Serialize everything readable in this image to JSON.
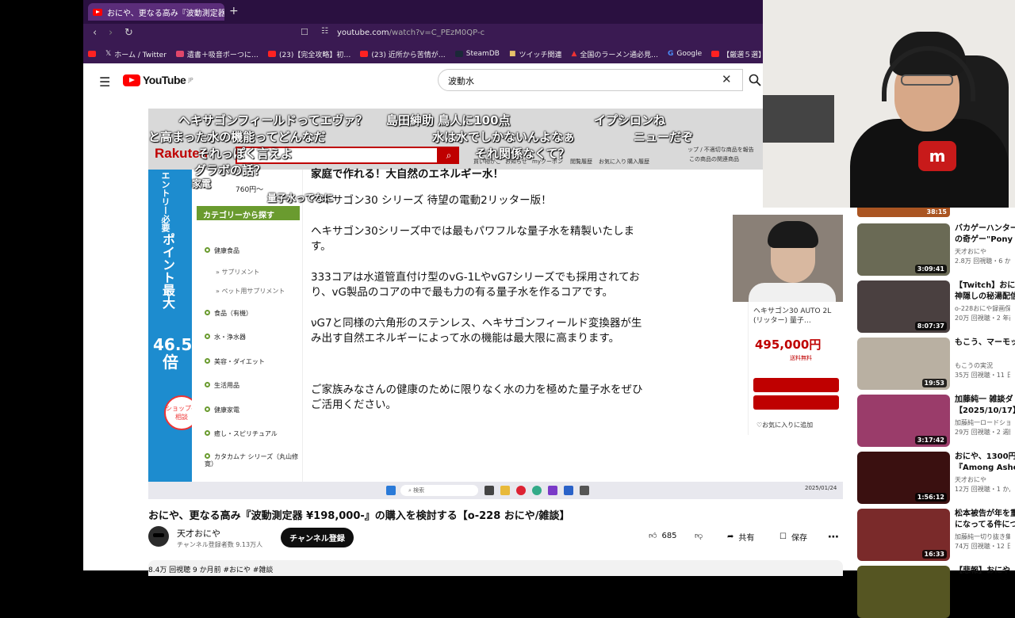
{
  "browser": {
    "tab_title": "おにや、更なる高み『波動測定器",
    "tab_close": "✕",
    "new_tab": "+",
    "url_host": "youtube.com",
    "url_path": "/watch?v=C_PEzM0QP-c",
    "bookmarks": [
      "ホーム / Twitter",
      "遺書＋吸音ボーつに…",
      "(23)【完全攻略】初…",
      "(23) 近所から苦情が…",
      "SteamDB",
      "ツイッチ関連",
      "全国のラーメン通必見…",
      "Google",
      "【厳選５選】今キテる…"
    ]
  },
  "youtube": {
    "logo_text": "YouTube",
    "logo_region": "JP",
    "search_query": "波動水",
    "clear_label": "✕"
  },
  "player": {
    "rakuten_logo": "Rakuten",
    "rakuten_links": [
      "買い物かご",
      "お知らせ",
      "myクーポン",
      "閲覧履歴",
      "お気に入り",
      "購入履歴",
      "この商品の関連商品"
    ],
    "rakuten_notice": "ップ / 不適切な商品を報告",
    "price_teaser": "760円～",
    "danmaku": [
      "ヘキサゴンフィールドってエヴァ？",
      "島田紳助 鳥人に100点",
      "イプシロンね",
      "と高まった水の機能ってどんなだ",
      "水は水でしかないんよなぁ",
      "ニューだぞ",
      "それっぽく言えよ",
      "それ関係なくて？",
      "グラボの話？",
      "量子水ってなに",
      "家電"
    ],
    "banner_vertical": "エントリー必要",
    "banner_main": "ポイント最大",
    "banner_rate": "46.5倍",
    "shop_badge": "ショップへ相談",
    "category_header": "カテゴリーから探す",
    "categories": [
      "健康食品",
      "サプリメント",
      "ペット用サプリメント",
      "食品（有機）",
      "水・浄水器",
      "美容・ダイエット",
      "生活用品",
      "健康家電",
      "癒し・スピリチュアル",
      "カタカムナ シリーズ（丸山修寛）"
    ],
    "desc_top": "家庭で作れる！大自然のエネルギー水！",
    "desc": [
      "ヘキサゴン30 シリーズ 待望の電動2リッター版！",
      "ヘキサゴン30シリーズ中では最もパワフルな量子水を精製いたします。",
      "333コアは水道管直付け型のvG-1LやvG7シリーズでも採用されており、vG製品のコアの中で最も力の有る量子水を作るコアです。",
      "νG7と同様の六角形のステンレス、ヘキサゴンフィールド変換器が生み出す自然エネルギーによって水の機能は最大限に高まります。",
      "ご家族みなさんの健康のために限りなく水の力を極めた量子水をぜひご活用ください。"
    ],
    "product_title": "ヘキサゴン30 AUTO 2L (リッター) 量子…",
    "product_price": "495,000円",
    "product_shipping": "送料無料",
    "product_fav": "♡お気に入りに追加",
    "taskbar_search": "検索",
    "clock": "2025/01/24"
  },
  "video": {
    "title": "おにや、更なる高み『波動測定器 ¥198,000-』の購入を検討する【o-228 おにや/雑談】",
    "channel": "天才おにや",
    "subscribers": "チャンネル登録者数 9.13万人",
    "subscribe_label": "チャンネル登録",
    "likes": "685",
    "share_label": "共有",
    "save_label": "保存",
    "meta": "8.4万 回視聴  9 か月前  #おにや #雑談"
  },
  "recommended": [
    {
      "title": "バカゲーハンター",
      "line2": "の奇ゲー\"Pony Is",
      "channel": "天才おにや",
      "stats": "2.8万 回視聴・6 か",
      "duration": "3:09:41",
      "color": "#6a6a55"
    },
    {
      "title": "【Twitch】おに",
      "line2": "神隠しの秘湯配信",
      "channel": "o-228おにや録画保管",
      "stats": "20万 回視聴・2 年前",
      "duration": "8:07:37",
      "color": "#4a4040"
    },
    {
      "title": "もこう、マーモッ",
      "line2": "",
      "channel": "もこうの実況",
      "stats": "35万 回視聴・11 日",
      "duration": "19:53",
      "color": "#b9b0a2"
    },
    {
      "title": "加藤純一 雑談ダ",
      "line2": "【2025/10/17】",
      "channel": "加藤純一ロードショ",
      "stats": "29万 回視聴・2 週間",
      "duration": "3:17:42",
      "color": "#9a3c6a"
    },
    {
      "title": "おにや、1300円の",
      "line2": "『Among Ashes』",
      "channel": "天才おにや",
      "stats": "12万 回視聴・1 か月",
      "duration": "1:56:12",
      "color": "#3a1010"
    },
    {
      "title": "松本被告が年を重",
      "line2": "になってる件につ",
      "channel": "加藤純一切り抜き集",
      "stats": "74万 回視聴・12 日",
      "duration": "16:33",
      "color": "#7a2a2a"
    },
    {
      "title": "【悲報】おにや",
      "line2": "",
      "channel": "",
      "stats": "",
      "duration": "",
      "color": "#552"
    }
  ],
  "top_thumb_duration": "38:15"
}
